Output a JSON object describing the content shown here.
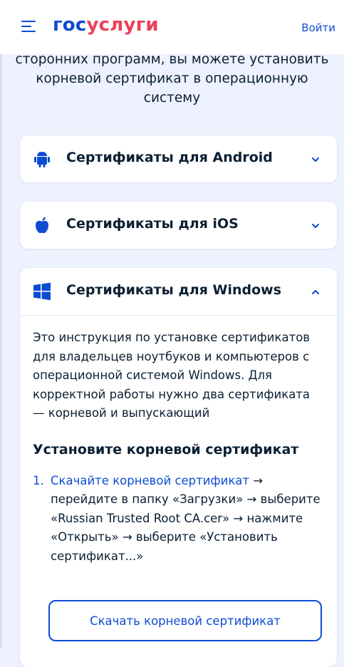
{
  "header": {
    "logo_part1": "гос",
    "logo_part2": "услуги",
    "login_label": "Войти"
  },
  "intro": {
    "text": "сторонних программ, вы можете установить корневой сертификат в операционную систему"
  },
  "accordions": [
    {
      "title": "Сертификаты для Android",
      "icon": "android-icon",
      "expanded": false
    },
    {
      "title": "Сертификаты для iOS",
      "icon": "apple-icon",
      "expanded": false
    },
    {
      "title": "Сертификаты для Windows",
      "icon": "windows-icon",
      "expanded": true
    }
  ],
  "windows": {
    "description": "Это инструкция по установке сертификатов для владельцев ноутбуков и компьютеров с операционной системой Windows. Для корректной работы нужно два сертификата — корневой и выпускающий",
    "subheading": "Установите корневой сертификат",
    "step1": {
      "number": "1.",
      "link": "Скачайте корневой сертификат",
      "rest": " → перейдите в папку «Загрузки» → выберите «Russian Trusted Root CA.cer» → нажмите «Открыть» → выберите «Установить сертификат...»"
    },
    "download_button": "Скачать корневой сертификат"
  },
  "colors": {
    "brand_blue": "#0d4cd3",
    "brand_red": "#ee3f58",
    "background": "#edf2fe",
    "android_green": "#3ddc84"
  }
}
